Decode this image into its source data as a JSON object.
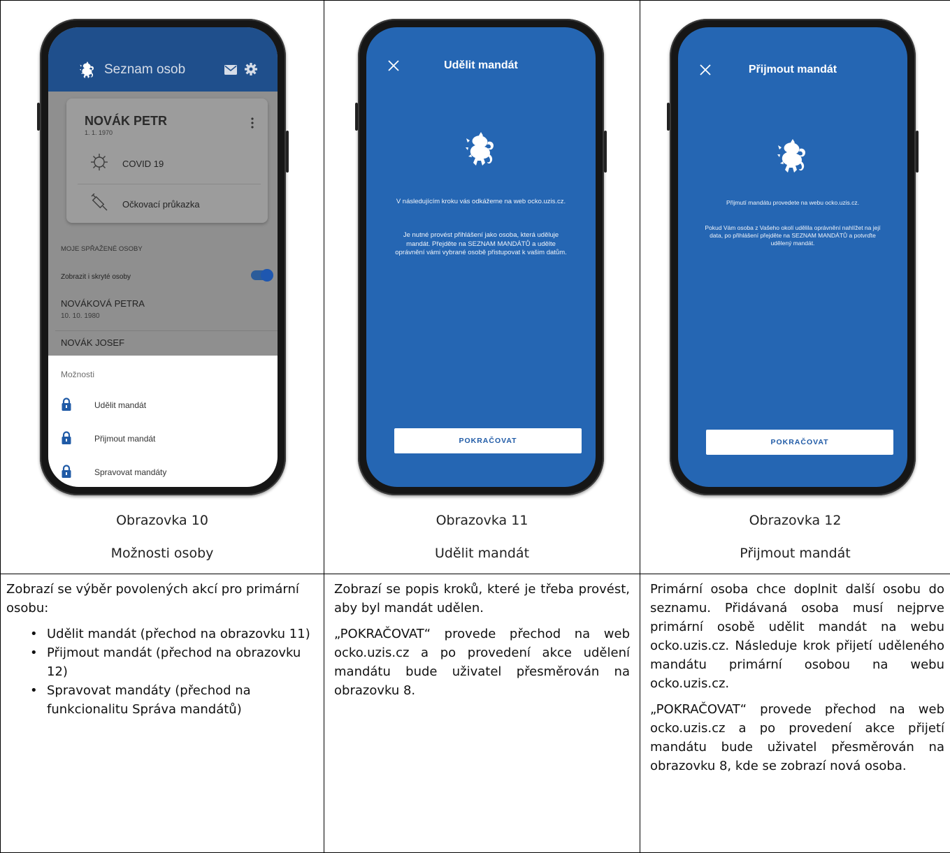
{
  "columns": [
    {
      "caption_number": "Obrazovka 10",
      "caption_name": "Možnosti osoby",
      "screen": {
        "app_title": "Seznam osob",
        "card": {
          "name": "NOVÁK PETR",
          "date": "1. 1. 1970",
          "items": [
            "COVID 19",
            "Očkovací průkazka"
          ]
        },
        "section_label": "MOJE SPŘAŽENÉ OSOBY",
        "toggle_label": "Zobrazit i skryté osoby",
        "persons": [
          {
            "name": "NOVÁKOVÁ PETRA",
            "date": "10. 10. 1980"
          },
          {
            "name": "NOVÁK JOSEF",
            "date": ""
          }
        ],
        "sheet_title": "Možnosti",
        "options": [
          "Udělit mandát",
          "Přijmout mandát",
          "Spravovat mandáty"
        ]
      },
      "description": {
        "intro": "Zobrazí se výběr povolených akcí pro primární osobu:",
        "bullets": [
          "Udělit mandát (přechod na obrazovku 11)",
          "Přijmout mandát (přechod na obrazovku 12)",
          "Spravovat mandáty (přechod na funkcionalitu Správa mandátů)"
        ]
      }
    },
    {
      "caption_number": "Obrazovka 11",
      "caption_name": "Udělit mandát",
      "screen": {
        "title": "Udělit mandát",
        "text1": "V následujícím kroku vás odkážeme na web ocko.uzis.cz.",
        "text2": "Je nutné provést přihlášení jako osoba, která uděluje mandát. Přejděte na SEZNAM MANDÁTŮ a udělte oprávnění vámi vybrané osobě přistupovat k vašim datům.",
        "button": "POKRAČOVAT"
      },
      "description": {
        "p1": "Zobrazí se popis kroků, které je třeba provést, aby byl mandát udělen.",
        "p2": "„POKRAČOVAT“ provede přechod na web ocko.uzis.cz a po provedení akce udělení mandátu bude uživatel přesměrován na obrazovku 8."
      }
    },
    {
      "caption_number": "Obrazovka 12",
      "caption_name": "Přijmout mandát",
      "screen": {
        "title": "Přijmout mandát",
        "text1": "Přijmutí mandátu provedete na webu ocko.uzis.cz.",
        "text2": "Pokud Vám osoba z Vašeho okolí udělila oprávnění nahlížet na její data, po přihlášení přejděte na SEZNAM MANDÁTŮ a potvrďte udělený mandát.",
        "button": "POKRAČOVAT"
      },
      "description": {
        "p1": "Primární osoba chce doplnit další osobu do seznamu. Přidávaná osoba musí nejprve primární osobě udělit mandát na webu ocko.uzis.cz. Následuje krok přijetí uděleného mandátu primární osobou na webu ocko.uzis.cz.",
        "p2": "„POKRAČOVAT“ provede přechod na web ocko.uzis.cz a po provedení akce přijetí mandátu bude uživatel přesměrován na obrazovku 8, kde se zobrazí nová osoba."
      }
    }
  ],
  "colors": {
    "app_blue": "#2566b3",
    "appbar_dark": "#1f4f8c",
    "lock_blue": "#1f5aa6"
  },
  "icons": [
    "lion-emblem-icon",
    "mail-icon",
    "gear-icon",
    "kebab-menu-icon",
    "virus-icon",
    "syringe-icon",
    "lock-icon",
    "close-icon"
  ]
}
